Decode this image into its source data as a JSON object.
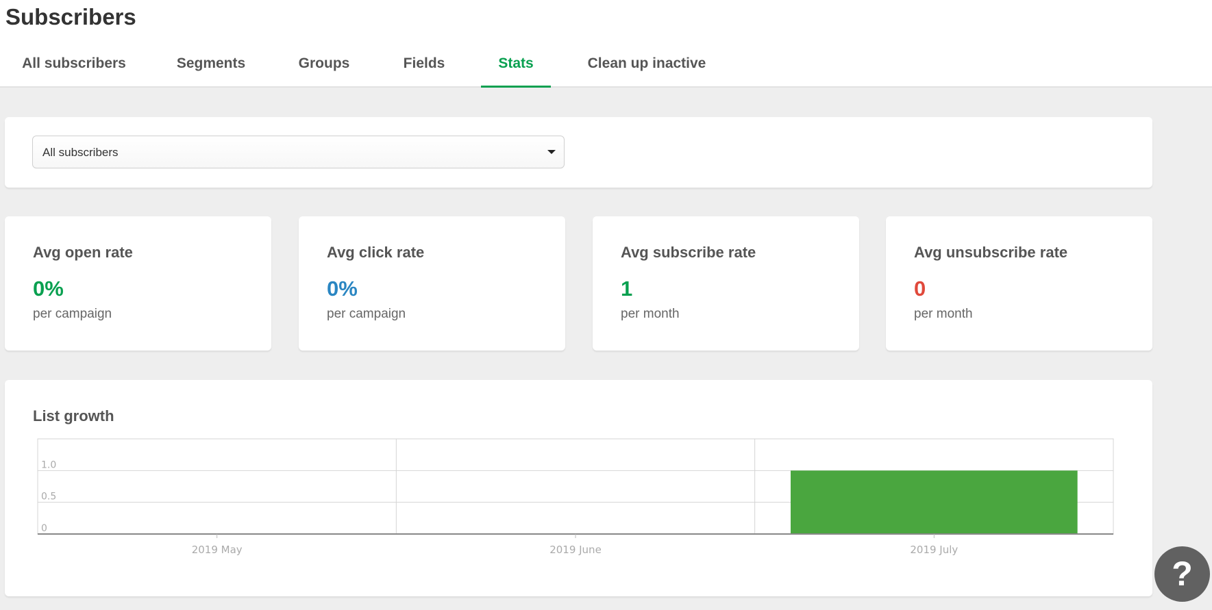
{
  "page": {
    "title": "Subscribers"
  },
  "tabs": [
    {
      "label": "All subscribers"
    },
    {
      "label": "Segments"
    },
    {
      "label": "Groups"
    },
    {
      "label": "Fields"
    },
    {
      "label": "Stats",
      "active": true
    },
    {
      "label": "Clean up inactive"
    }
  ],
  "filter": {
    "selected": "All subscribers"
  },
  "stats": [
    {
      "title": "Avg open rate",
      "value": "0%",
      "sub": "per campaign",
      "color": "#09a050"
    },
    {
      "title": "Avg click rate",
      "value": "0%",
      "sub": "per campaign",
      "color": "#2a86c2"
    },
    {
      "title": "Avg subscribe rate",
      "value": "1",
      "sub": "per month",
      "color": "#09a050"
    },
    {
      "title": "Avg unsubscribe rate",
      "value": "0",
      "sub": "per month",
      "color": "#e0493b"
    }
  ],
  "chart_card": {
    "title": "List growth"
  },
  "chart_data": {
    "type": "bar",
    "title": "List growth",
    "categories": [
      "2019 May",
      "2019 June",
      "2019 July"
    ],
    "values": [
      0,
      0,
      1
    ],
    "y_ticks": [
      "0",
      "0.5",
      "1.0"
    ],
    "ylim": [
      0,
      1.5
    ],
    "grid": true,
    "bar_color": "#4aa63f"
  },
  "help": {
    "label": "?",
    "icon": "question-mark-icon"
  }
}
